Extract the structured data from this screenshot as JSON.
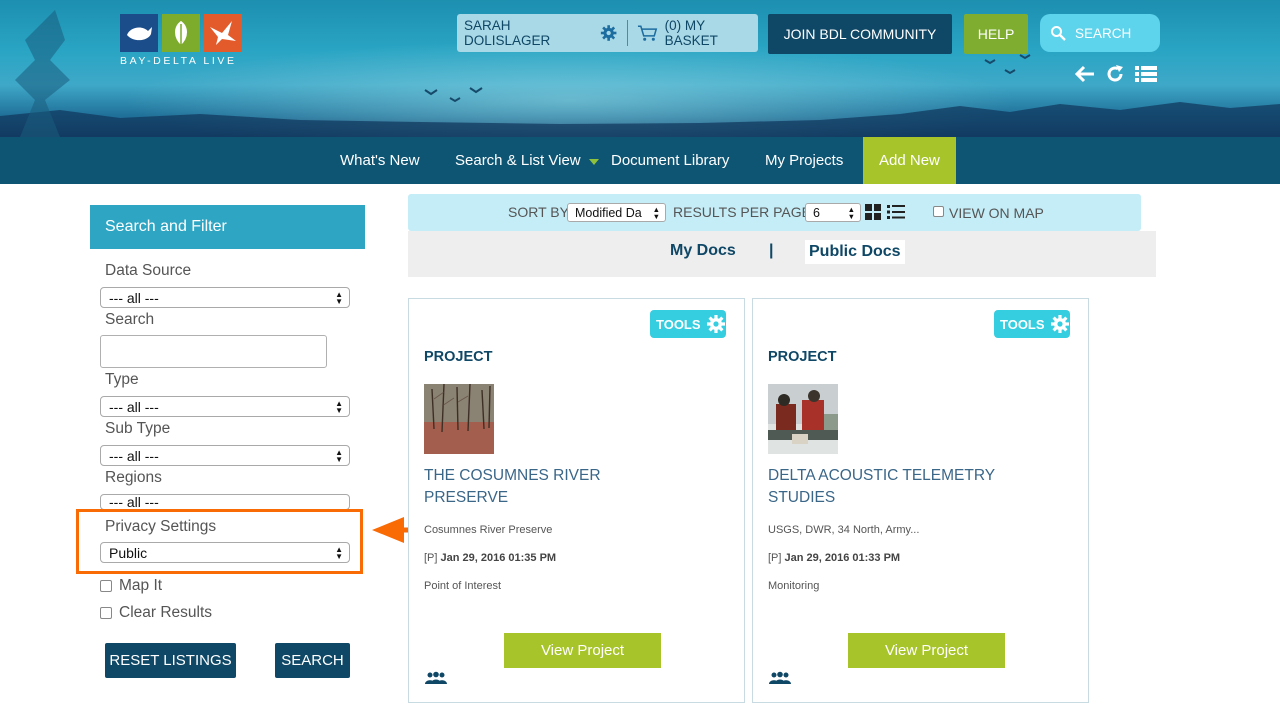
{
  "header": {
    "logo_text": "BAY-DELTA LIVE",
    "user_name": "SARAH DOLISLAGER",
    "basket_label": "(0) MY BASKET",
    "join_label": "JOIN BDL COMMUNITY",
    "help_label": "HELP",
    "search_placeholder": "SEARCH"
  },
  "nav": {
    "items": [
      "What's New",
      "Search & List View",
      "Document Library",
      "My Projects",
      "Add New"
    ]
  },
  "sidebar": {
    "title": "Search and Filter",
    "data_source_label": "Data Source",
    "data_source_value": "--- all ---",
    "search_label": "Search",
    "type_label": "Type",
    "type_value": "--- all ---",
    "subtype_label": "Sub Type",
    "subtype_value": "--- all ---",
    "regions_label": "Regions",
    "regions_value": "--- all ---",
    "privacy_label": "Privacy Settings",
    "privacy_value": "Public",
    "map_it_label": "Map It",
    "clear_results_label": "Clear Results",
    "reset_label": "RESET LISTINGS",
    "search_button": "SEARCH"
  },
  "toolbar": {
    "sort_label": "SORT BY",
    "sort_value": "Modified Da",
    "rpp_label": "RESULTS PER PAGE",
    "rpp_value": "6",
    "view_on_map": "VIEW ON MAP"
  },
  "docs_tabs": {
    "my_docs": "My Docs",
    "separator": "|",
    "public_docs": "Public Docs"
  },
  "cards": [
    {
      "tools_label": "TOOLS",
      "category": "PROJECT",
      "title": "THE COSUMNES RIVER PRESERVE",
      "subtitle": "Cosumnes River Preserve",
      "date_prefix": "[P]",
      "date": "Jan 29, 2016 01:35 PM",
      "tag": "Point of Interest",
      "button": "View Project"
    },
    {
      "tools_label": "TOOLS",
      "category": "PROJECT",
      "title": "DELTA ACOUSTIC TELEMETRY STUDIES",
      "subtitle": "USGS, DWR, 34 North, Army...",
      "date_prefix": "[P]",
      "date": "Jan 29, 2016 01:33 PM",
      "tag": "Monitoring",
      "button": "View Project"
    }
  ],
  "colors": {
    "navy": "#0f4766",
    "nav_bar": "#0e5574",
    "teal": "#2ea6c3",
    "green": "#a7c52a",
    "highlight_orange": "#f96b05"
  }
}
